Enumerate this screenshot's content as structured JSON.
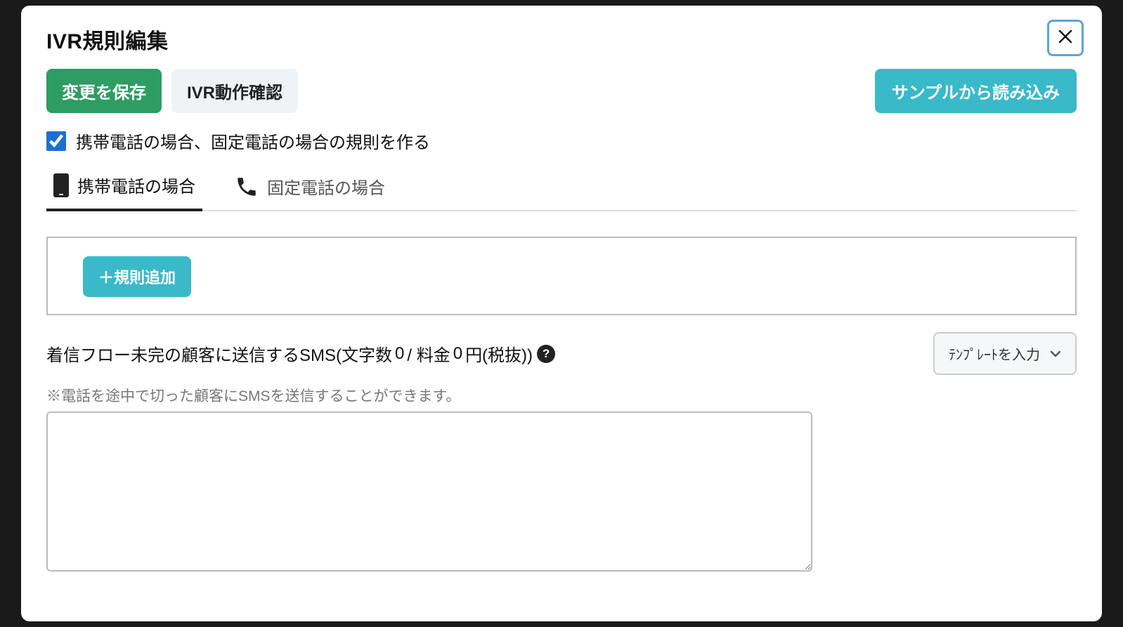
{
  "modal": {
    "title": "IVR規則編集"
  },
  "buttons": {
    "save": "変更を保存",
    "ivr_check": "IVR動作確認",
    "load_sample": "サンプルから読み込み",
    "add_rule": "＋規則追加"
  },
  "checkbox": {
    "label": "携帯電話の場合、固定電話の場合の規則を作る",
    "checked": true
  },
  "tabs": {
    "mobile": "携帯電話の場合",
    "landline": "固定電話の場合"
  },
  "sms": {
    "label_prefix": "着信フロー未完の顧客に送信するSMS(文字数",
    "char_count": "0",
    "label_mid": " / 料金",
    "price": "0",
    "label_suffix": "円(税抜))",
    "note": "※電話を途中で切った顧客にSMSを送信することができます。",
    "template_label": "ﾃﾝﾌﾟﾚｰﾄを入力"
  }
}
